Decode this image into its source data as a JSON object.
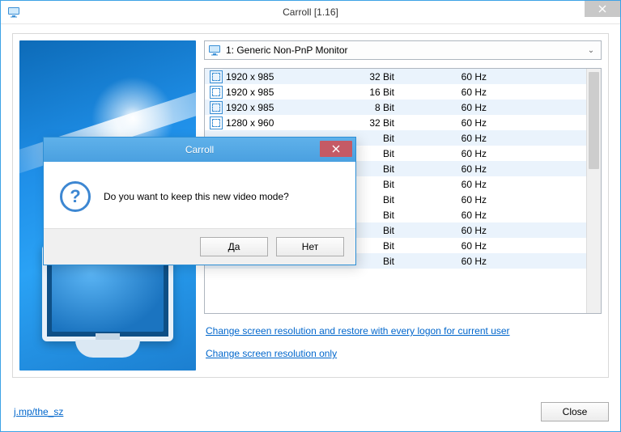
{
  "window": {
    "title": "Carroll [1.16]"
  },
  "monitor_select": {
    "text": "1: Generic Non-PnP Monitor"
  },
  "resolutions": [
    {
      "res": "1920 x 985",
      "depth": "32 Bit",
      "refresh": "60 Hz"
    },
    {
      "res": "1920 x 985",
      "depth": "16 Bit",
      "refresh": "60 Hz"
    },
    {
      "res": "1920 x 985",
      "depth": "8 Bit",
      "refresh": "60 Hz"
    },
    {
      "res": "1280 x 960",
      "depth": "32 Bit",
      "refresh": "60 Hz"
    },
    {
      "res": "",
      "depth": "Bit",
      "refresh": "60 Hz"
    },
    {
      "res": "",
      "depth": "Bit",
      "refresh": "60 Hz"
    },
    {
      "res": "",
      "depth": "Bit",
      "refresh": "60 Hz"
    },
    {
      "res": "",
      "depth": "Bit",
      "refresh": "60 Hz"
    },
    {
      "res": "",
      "depth": "Bit",
      "refresh": "60 Hz",
      "selected": true
    },
    {
      "res": "",
      "depth": "Bit",
      "refresh": "60 Hz"
    },
    {
      "res": "",
      "depth": "Bit",
      "refresh": "60 Hz"
    },
    {
      "res": "",
      "depth": "Bit",
      "refresh": "60 Hz"
    },
    {
      "res": "",
      "depth": "Bit",
      "refresh": "60 Hz"
    }
  ],
  "links": {
    "logon": "Change screen resolution and restore with every logon for current user",
    "only": "Change screen resolution only"
  },
  "footer": {
    "url": "j.mp/the_sz",
    "close": "Close"
  },
  "dialog": {
    "title": "Carroll",
    "message": "Do you want to keep this new video mode?",
    "yes": "Да",
    "no": "Нет"
  }
}
